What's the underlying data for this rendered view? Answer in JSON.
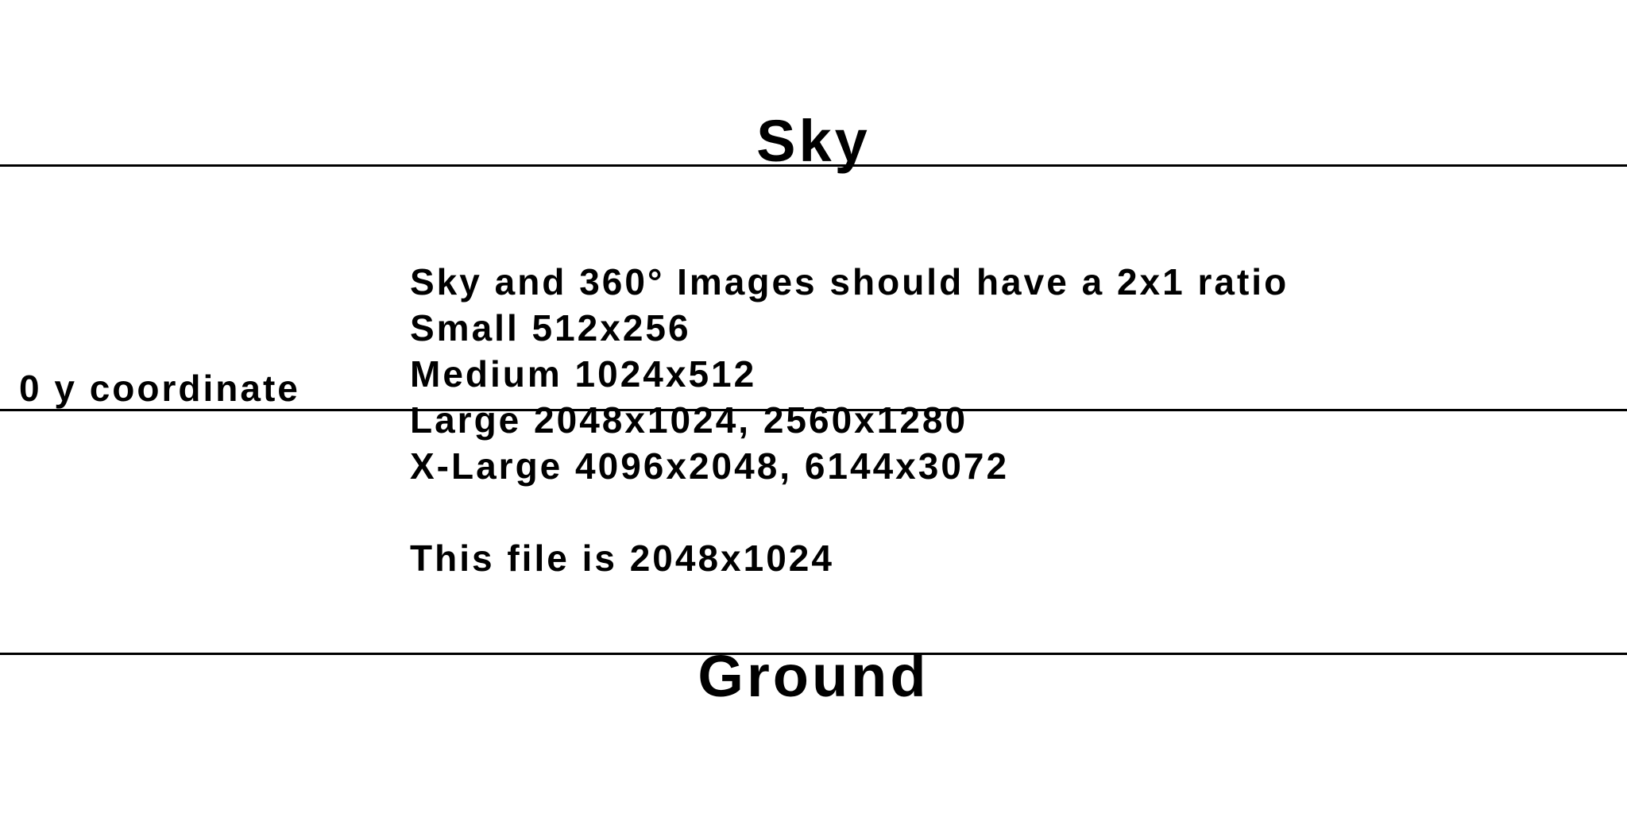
{
  "sky_label": "Sky",
  "ground_label": "Ground",
  "zero_label": "0 y coordinate",
  "info": {
    "ratio_note": "Sky and 360° Images should have a 2x1 ratio",
    "small": "Small 512x256",
    "medium": "Medium 1024x512",
    "large": "Large 2048x1024, 2560x1280",
    "xlarge": "X-Large 4096x2048, 6144x3072",
    "file_size": "This file is 2048x1024"
  }
}
